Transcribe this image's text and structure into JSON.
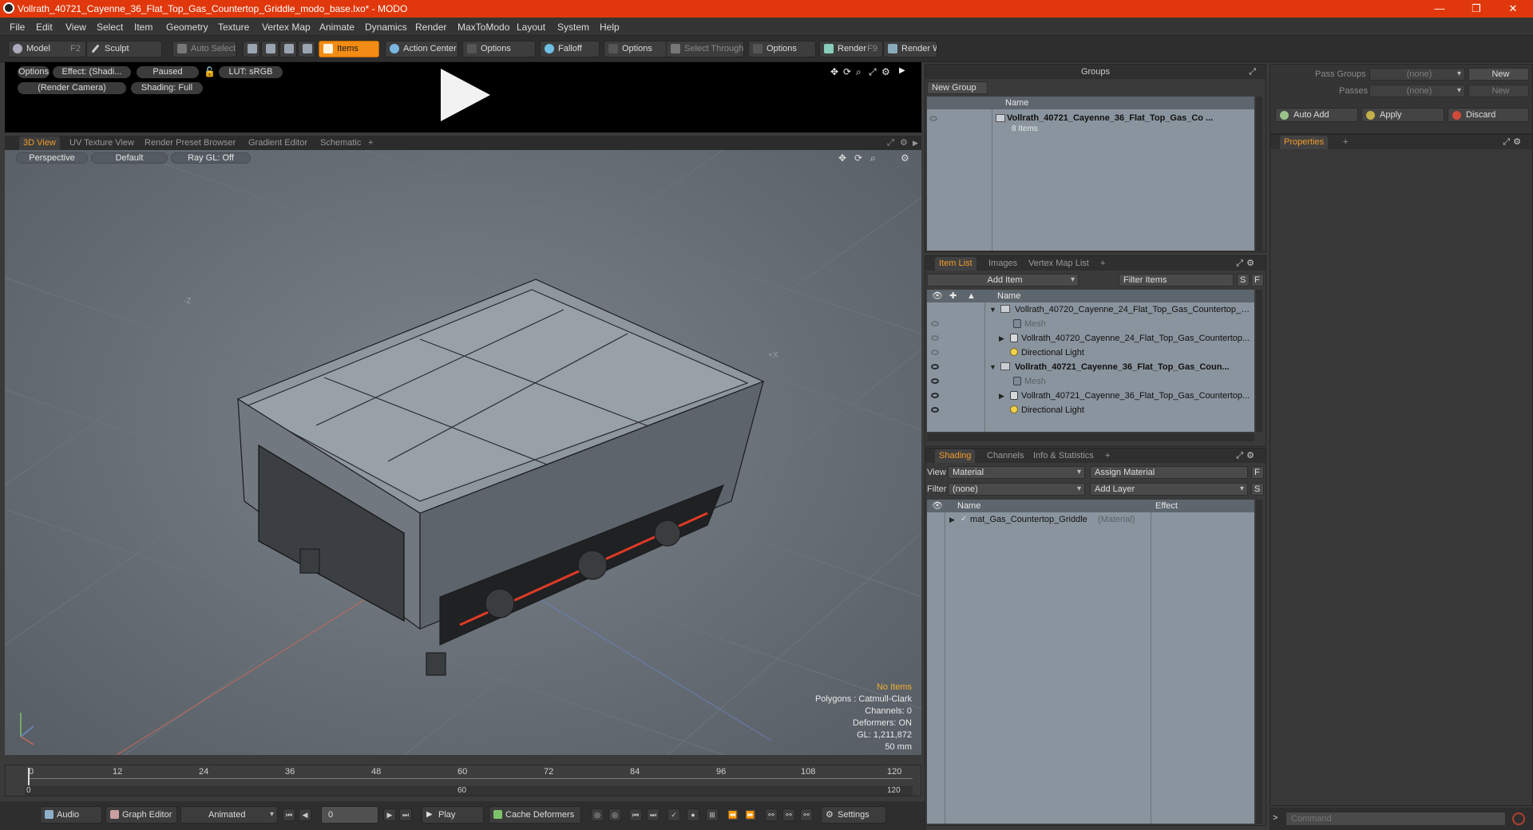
{
  "window": {
    "title": "Vollrath_40721_Cayenne_36_Flat_Top_Gas_Countertop_Griddle_modo_base.lxo* - MODO",
    "minimize": "—",
    "restore": "❐",
    "close": "✕"
  },
  "menu": [
    "File",
    "Edit",
    "View",
    "Select",
    "Item",
    "Geometry",
    "Texture",
    "Vertex Map",
    "Animate",
    "Dynamics",
    "Render",
    "MaxToModo",
    "Layout",
    "System",
    "Help"
  ],
  "toolbar": {
    "model": "Model",
    "model_key": "F2",
    "sculpt": "Sculpt",
    "auto_select": "Auto Select",
    "items": "Items",
    "action_center": "Action Center",
    "options1": "Options",
    "falloff": "Falloff",
    "options2": "Options",
    "select_through": "Select Through",
    "options3": "Options",
    "render": "Render",
    "render_key": "F9",
    "render_window": "Render Window"
  },
  "preview": {
    "options": "Options",
    "effect": "Effect: (Shadi...",
    "paused": "Paused",
    "lut": "LUT: sRGB",
    "camera": "(Render Camera)",
    "shading": "Shading: Full"
  },
  "viewport_tabs": [
    "3D View",
    "UV Texture View",
    "Render Preset Browser",
    "Gradient Editor",
    "Schematic",
    "+"
  ],
  "viewport": {
    "perspective": "Perspective",
    "default": "Default",
    "raygl": "Ray GL: Off",
    "axis_z": "-Z",
    "axis_x": "+X",
    "info": {
      "no_items": "No Items",
      "polygons": "Polygons : Catmull-Clark",
      "channels": "Channels: 0",
      "deformers": "Deformers: ON",
      "gl": "GL: 1,211,872",
      "unit": "50 mm"
    }
  },
  "timeline": {
    "ticks": [
      "0",
      "12",
      "24",
      "36",
      "48",
      "60",
      "72",
      "84",
      "96",
      "108",
      "120"
    ],
    "sub_start": "0",
    "sub_mid": "60",
    "sub_end": "120"
  },
  "transport": {
    "audio": "Audio",
    "graph_editor": "Graph Editor",
    "animated": "Animated",
    "frame": "0",
    "play": "Play",
    "cache": "Cache Deformers",
    "settings": "Settings"
  },
  "groups": {
    "title": "Groups",
    "new_group": "New Group",
    "col_name": "Name",
    "row_name": "Vollrath_40721_Cayenne_36_Flat_Top_Gas_Co ...",
    "row_count": "8 Items"
  },
  "itemlist": {
    "tabs": [
      "Item List",
      "Images",
      "Vertex Map List",
      "+"
    ],
    "add_item": "Add Item",
    "filter": "Filter Items",
    "s": "S",
    "f": "F",
    "col_name": "Name",
    "rows": [
      "Vollrath_40720_Cayenne_24_Flat_Top_Gas_Countertop_G...",
      "Mesh",
      "Vollrath_40720_Cayenne_24_Flat_Top_Gas_Countertop...",
      "Directional Light",
      "Vollrath_40721_Cayenne_36_Flat_Top_Gas_Coun...",
      "Mesh",
      "Vollrath_40721_Cayenne_36_Flat_Top_Gas_Countertop...",
      "Directional Light"
    ]
  },
  "shading": {
    "tabs": [
      "Shading",
      "Channels",
      "Info & Statistics",
      "+"
    ],
    "view_label": "View",
    "view_value": "Material",
    "assign": "Assign Material",
    "f": "F",
    "filter_label": "Filter",
    "filter_value": "(none)",
    "add_layer": "Add Layer",
    "s": "S",
    "col_name": "Name",
    "col_effect": "Effect",
    "row_name": "mat_Gas_Countertop_Griddle",
    "row_type": "(Material)"
  },
  "passes": {
    "pass_groups": "Pass Groups",
    "passes": "Passes",
    "none": "(none)",
    "new": "New",
    "auto_add": "Auto Add",
    "apply": "Apply",
    "discard": "Discard"
  },
  "properties": {
    "tab": "Properties",
    "plus": "+"
  },
  "command": {
    "prompt": ">",
    "placeholder": "Command"
  }
}
